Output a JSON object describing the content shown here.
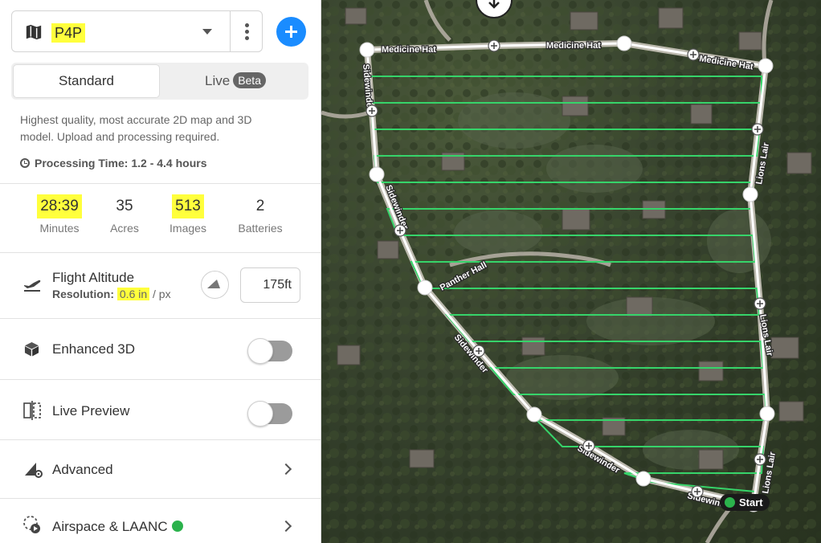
{
  "header": {
    "drone_name": "P4P",
    "icons": [
      "map-icon",
      "chevron-down-icon",
      "more-vertical-icon",
      "plus-icon"
    ]
  },
  "modes": {
    "standard": "Standard",
    "live": "Live",
    "beta": "Beta"
  },
  "description": "Highest quality, most accurate 2D map and 3D model. Upload and processing required.",
  "processing": {
    "label": "Processing Time:",
    "value": "1.2 - 4.4 hours"
  },
  "stats": [
    {
      "value": "28:39",
      "label": "Minutes",
      "highlight": true
    },
    {
      "value": "35",
      "label": "Acres",
      "highlight": false
    },
    {
      "value": "513",
      "label": "Images",
      "highlight": true
    },
    {
      "value": "2",
      "label": "Batteries",
      "highlight": false
    }
  ],
  "altitude": {
    "title": "Flight Altitude",
    "resolution_label": "Resolution:",
    "resolution_value": "0.6 in",
    "resolution_unit": "/ px",
    "value": "175ft"
  },
  "settings": {
    "enhanced_3d": {
      "label": "Enhanced 3D",
      "enabled": false
    },
    "live_preview": {
      "label": "Live Preview",
      "enabled": false
    },
    "advanced": {
      "label": "Advanced"
    },
    "airspace": {
      "label": "Airspace & LAANC",
      "status_color": "#2bb24c"
    }
  },
  "map": {
    "streets": {
      "medicine_hat_1": "Medicine Hat",
      "medicine_hat_2": "Medicine Hat",
      "medicine_hat_3": "Medicine Hat",
      "sidewinder_1": "Sidewinder",
      "sidewinder_2": "Sidewinder",
      "sidewinder_3": "Sidewinder",
      "sidewinder_4": "Sidewinder",
      "sidewinder_5": "Sidewinder",
      "panther_hall": "Panther Hall",
      "lions_lair_1": "Lions Lair",
      "lions_lair_2": "Lions Lair",
      "lions_lair_3": "Lions Lair"
    },
    "start_label": "Start",
    "colors": {
      "boundary": "#ffffff",
      "flight_path": "#36d46a",
      "accent": "#1a8cff",
      "highlight": "#ffff3c"
    }
  }
}
